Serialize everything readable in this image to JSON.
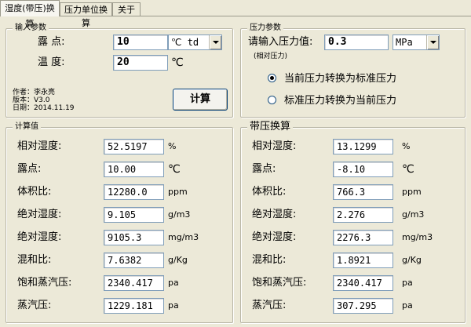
{
  "tabs": [
    {
      "label": "湿度(带压)换算"
    },
    {
      "label": "压力单位换算"
    },
    {
      "label": "关于"
    }
  ],
  "input_group": {
    "title": "输入参数",
    "dewpoint_label": "露  点:",
    "dewpoint_value": "10",
    "dewpoint_unit": "℃ td",
    "temperature_label": "温  度:",
    "temperature_value": "20",
    "temperature_unit": "℃",
    "author_line": "作者：李永亮",
    "version_line": "版本：V3.0",
    "date_line": "日期：2014.11.19",
    "calc_button": "计算"
  },
  "pressure_group": {
    "title": "压力参数",
    "input_label": "请输入压力值:",
    "input_value": "0.3",
    "unit_selected": "MPa",
    "relative_note": "(相对压力)",
    "option_to_standard": "当前压力转换为标准压力",
    "option_to_current": "标准压力转换为当前压力",
    "selected_option": "to_standard"
  },
  "calc_group": {
    "title": "计算值",
    "rows": [
      {
        "label": "相对湿度:",
        "value": "52.5197",
        "unit": "%"
      },
      {
        "label": "露点:",
        "value": "10.00",
        "unit": "℃"
      },
      {
        "label": "体积比:",
        "value": "12280.0",
        "unit": "ppm"
      },
      {
        "label": "绝对湿度:",
        "value": "9.105",
        "unit": "g/m3"
      },
      {
        "label": "绝对湿度:",
        "value": "9105.3",
        "unit": "mg/m3"
      },
      {
        "label": "混和比:",
        "value": "7.6382",
        "unit": "g/Kg"
      },
      {
        "label": "饱和蒸汽压:",
        "value": "2340.417",
        "unit": "pa"
      },
      {
        "label": "蒸汽压:",
        "value": "1229.181",
        "unit": "pa"
      }
    ]
  },
  "pressure_calc_group": {
    "title": "带压换算",
    "rows": [
      {
        "label": "相对湿度:",
        "value": "13.1299",
        "unit": "%"
      },
      {
        "label": "露点:",
        "value": "-8.10",
        "unit": "℃"
      },
      {
        "label": "体积比:",
        "value": "766.3",
        "unit": "ppm"
      },
      {
        "label": "绝对湿度:",
        "value": "2.276",
        "unit": "g/m3"
      },
      {
        "label": "绝对湿度:",
        "value": "2276.3",
        "unit": "mg/m3"
      },
      {
        "label": "混和比:",
        "value": "1.8921",
        "unit": "g/Kg"
      },
      {
        "label": "饱和蒸汽压:",
        "value": "2340.417",
        "unit": "pa"
      },
      {
        "label": "蒸汽压:",
        "value": "307.295",
        "unit": "pa"
      }
    ]
  }
}
